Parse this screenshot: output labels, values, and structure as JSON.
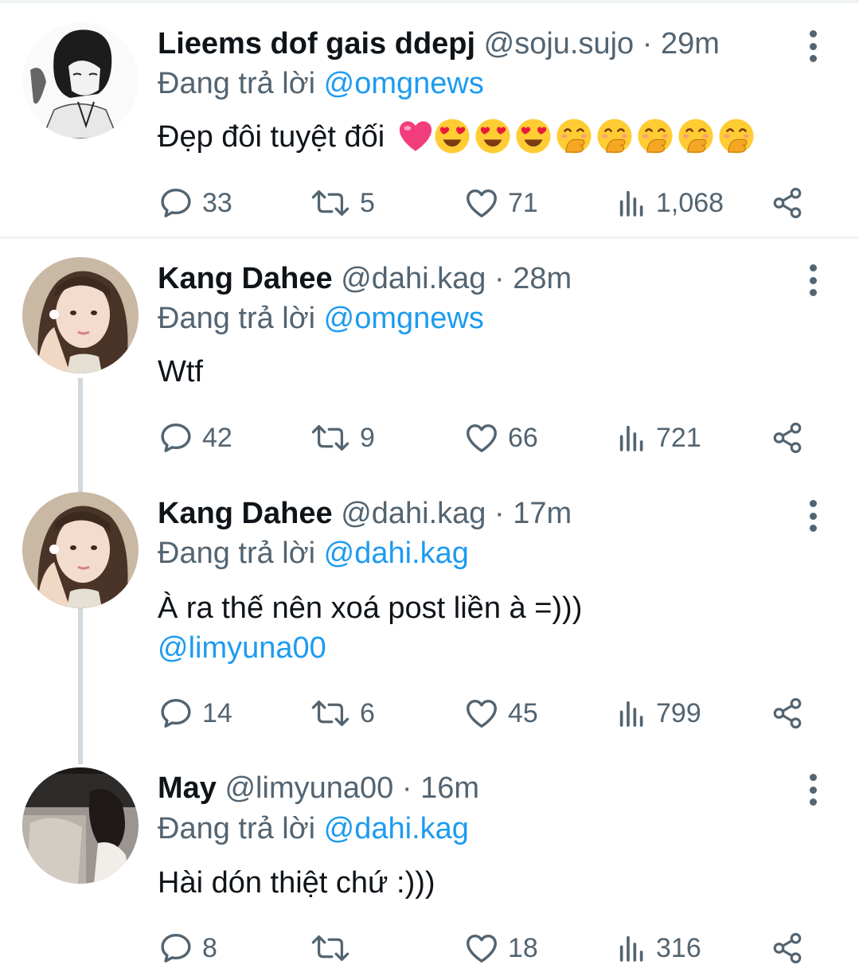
{
  "reply_prefix": "Đang trả lời",
  "colors": {
    "link": "#1d9bf0",
    "secondary": "#536471",
    "divider": "#eff3f4",
    "thread": "#cfd9de"
  },
  "tweets": [
    {
      "name": "Lieems dof gais ddepj",
      "handle": "@soju.sujo",
      "sep": "·",
      "time": "29m",
      "replying_to": "@omgnews",
      "text_lines": [
        "Đẹp đôi tuyệt đối"
      ],
      "emojis": [
        "heart",
        "heart-eyes",
        "heart-eyes",
        "heart-eyes",
        "hand-over-mouth",
        "hand-over-mouth",
        "hand-over-mouth",
        "hand-over-mouth",
        "hand-over-mouth"
      ],
      "replies": "33",
      "retweets": "5",
      "likes": "71",
      "views": "1,068"
    },
    {
      "name": "Kang Dahee",
      "handle": "@dahi.kag",
      "sep": "·",
      "time": "28m",
      "replying_to": "@omgnews",
      "text_lines": [
        "Wtf"
      ],
      "replies": "42",
      "retweets": "9",
      "likes": "66",
      "views": "721"
    },
    {
      "name": "Kang Dahee",
      "handle": "@dahi.kag",
      "sep": "·",
      "time": "17m",
      "replying_to": "@dahi.kag",
      "text_lines": [
        "À ra thế nên xoá post liền à =)))"
      ],
      "text_mention": "@limyuna00",
      "replies": "14",
      "retweets": "6",
      "likes": "45",
      "views": "799"
    },
    {
      "name": "May",
      "handle": "@limyuna00",
      "sep": "·",
      "time": "16m",
      "replying_to": "@dahi.kag",
      "text_lines": [
        "Hài dón thiệt chứ :)))"
      ],
      "replies": "8",
      "retweets": "",
      "likes": "18",
      "views": "316"
    }
  ]
}
